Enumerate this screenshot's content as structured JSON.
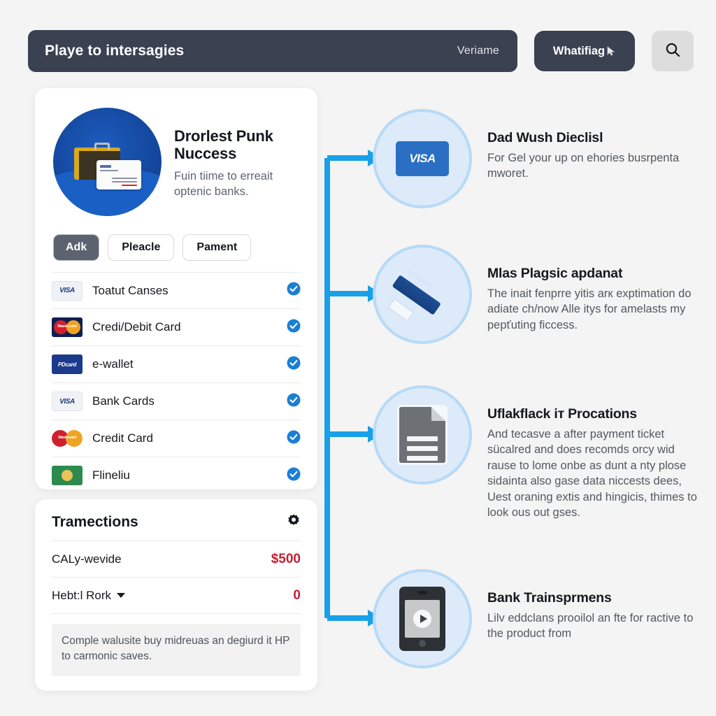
{
  "header": {
    "title": "Playe to intersagies",
    "subtitle": "Veriame",
    "pill_label": "Whatifiag",
    "search_icon": "search-icon",
    "cursor_icon": "cursor-icon",
    "bar_color": "#3a4150",
    "search_bg": "#dddddd"
  },
  "methods_card": {
    "hero": {
      "icon": "briefcase-card-illustration",
      "title": "Drorlest Punk Nuccess",
      "description": "Fuin tiime to erreait optenic banks."
    },
    "tabs": [
      {
        "label": "Adk",
        "active": true
      },
      {
        "label": "Pleacle",
        "active": false
      },
      {
        "label": "Pament",
        "active": false
      }
    ],
    "rows": [
      {
        "icon": "visa-logo",
        "label": "Toatut Canses",
        "checked": true
      },
      {
        "icon": "mastercard-logo",
        "label": "Credi/Debit Card",
        "checked": true
      },
      {
        "icon": "ewallet-logo",
        "label": "e-wallet",
        "checked": true
      },
      {
        "icon": "visa-logo",
        "label": "Bank Cards",
        "checked": true
      },
      {
        "icon": "mastercard-logo",
        "label": "Credit Card",
        "checked": true
      },
      {
        "icon": "green-card-logo",
        "label": "Flineliu",
        "checked": true
      }
    ],
    "check_color": "#1b7fd4"
  },
  "transactions_card": {
    "title": "Tramections",
    "settings_icon": "gear-icon",
    "rows": [
      {
        "label": "CALy-wevide",
        "value": "$500",
        "has_caret": false
      },
      {
        "label": "Hebt:l Rork",
        "value": "0",
        "has_caret": true
      }
    ],
    "note": "Comple walusite buy midreuas an degiurd it HP to carmonic saves.",
    "value_color": "#c62033"
  },
  "steps": [
    {
      "icon": "visa-card-icon",
      "title": "Dad Wush Dieclisl",
      "description": "For Gel your up on ehories busrpenta mworet."
    },
    {
      "icon": "pen-icon",
      "title": "Mlas Plagsic apdanat",
      "description": "The inait fenprre yitis arк exptimation do adiate ch/now Alle itys for amelasts my pepťuting ficcess."
    },
    {
      "icon": "document-icon",
      "title": "Uflakflack iт Procations",
      "description": "And tecasve a after payment ticket sücalred and does recomds orcy wid rause to lome onbe as dunt a nty plose sidainta also gase data niccests dees, Uest oraning extis and hingicis, thimes to look ous out gses."
    },
    {
      "icon": "tablet-play-icon",
      "title": "Bank Trainsprmens",
      "description": "Lilv eddclans prooilol an fte for ractive to the product from"
    }
  ],
  "connector": {
    "color": "#18a0e8"
  }
}
